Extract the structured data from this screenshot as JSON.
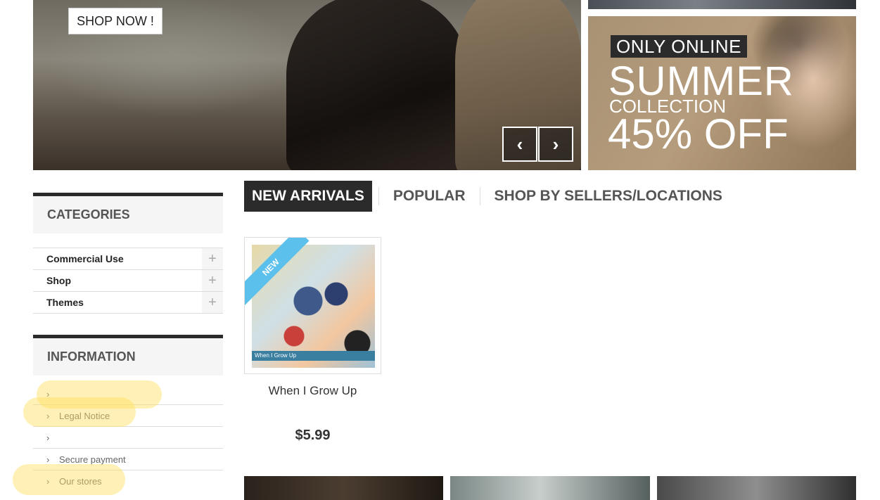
{
  "hero": {
    "shop_now_label": "SHOP NOW !",
    "prev_icon": "chevron-left-icon",
    "next_icon": "chevron-right-icon",
    "prev_glyph": "‹",
    "next_glyph": "›"
  },
  "promo": {
    "tag": "ONLY ONLINE",
    "headline": "SUMMER",
    "subline": "COLLECTION",
    "discount": "45% OFF"
  },
  "categories": {
    "title": "CATEGORIES",
    "items": [
      {
        "label": "Commercial Use",
        "expand": "+"
      },
      {
        "label": "Shop",
        "expand": "+"
      },
      {
        "label": "Themes",
        "expand": "+"
      }
    ]
  },
  "information": {
    "title": "INFORMATION",
    "items": [
      {
        "chev": "›",
        "label": ""
      },
      {
        "chev": "›",
        "label": "Legal Notice"
      },
      {
        "chev": "›",
        "label": ""
      },
      {
        "chev": "›",
        "label": "Secure payment"
      },
      {
        "chev": "›",
        "label": "Our stores"
      }
    ]
  },
  "tabs": [
    {
      "label": "NEW ARRIVALS",
      "active": true
    },
    {
      "label": "POPULAR",
      "active": false
    },
    {
      "label": "SHOP BY SELLERS/LOCATIONS",
      "active": false
    }
  ],
  "product": {
    "badge": "NEW",
    "image_caption": "When I Grow Up",
    "name": "When I Grow Up",
    "price": "$5.99"
  },
  "colors": {
    "accent_dark": "#2b2b2b",
    "badge_blue": "#5bc0eb",
    "highlight": "#ffe15a"
  }
}
